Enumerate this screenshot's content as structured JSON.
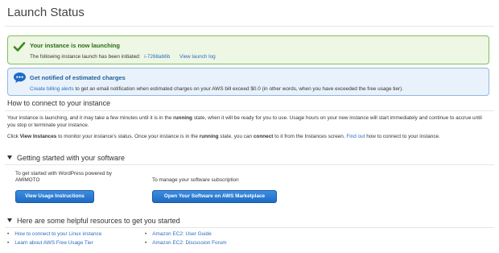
{
  "page": {
    "title": "Launch Status"
  },
  "success_alert": {
    "title": "Your instance is now launching",
    "text": "The following instance launch has been initiated:",
    "instance_id": "i-7268ab6b",
    "log_link": "View launch log",
    "color": "#2c6d12"
  },
  "info_alert": {
    "title": "Get notified of estimated charges",
    "link": "Create billing alerts",
    "text": " to get an email notification when estimated charges on your AWS bill exceed $0.0 (in other words, when you have exceeded the free usage tier).",
    "color": "#1f5f99"
  },
  "connect": {
    "heading": "How to connect to your instance",
    "para1": {
      "part1": "Your instance is launching, and it may take a few minutes until it is in the ",
      "bold1": "running",
      "part2": " state, when it will be ready for you to use. Usage hours on your new instance will start immediately and continue to accrue until you stop or terminate your instance."
    },
    "para2": {
      "part1": "Click ",
      "bold1": "View Instances",
      "part2": " to monitor your instance's status. Once your instance is in the ",
      "bold2": "running",
      "part3": " state, you can ",
      "bold3": "connect",
      "part4": " to it from the Instances screen. ",
      "link": "Find out",
      "part5": " how to connect to your instance."
    }
  },
  "software": {
    "heading": "Getting started with your software",
    "left_text": "To get started with WordPress powered by AMIMOTO",
    "left_button": "View Usage Instructions",
    "right_text": "To manage your software subscription",
    "right_button": "Open Your Software on AWS Marketplace",
    "button_color": "#1f6bc4"
  },
  "resources": {
    "heading": "Here are some helpful resources to get you started",
    "items": [
      "How to connect to your Linux instance",
      "Learn about AWS Free Usage Tier",
      "Amazon EC2: User Guide",
      "Amazon EC2: Discussion Forum"
    ]
  }
}
